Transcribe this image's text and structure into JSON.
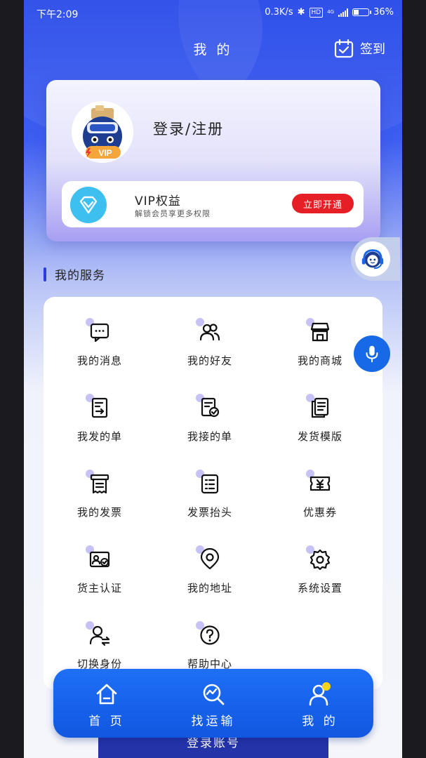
{
  "status_bar": {
    "time": "下午2:09",
    "network_speed": "0.3K/s",
    "hd": "HD",
    "network_type": "4G",
    "battery_percent": 36,
    "battery_text": "36%"
  },
  "header": {
    "title": "我 的",
    "checkin_label": "签到"
  },
  "profile": {
    "login_text": "登录/注册",
    "avatar_badge": "VIP",
    "vip": {
      "title": "VIP权益",
      "subtitle": "解锁会员享更多权限",
      "button": "立即开通"
    }
  },
  "services": {
    "title": "我的服务",
    "items": [
      {
        "label": "我的消息",
        "icon": "message-icon"
      },
      {
        "label": "我的好友",
        "icon": "friends-icon"
      },
      {
        "label": "我的商城",
        "icon": "store-icon"
      },
      {
        "label": "我发的单",
        "icon": "sent-order-icon"
      },
      {
        "label": "我接的单",
        "icon": "received-order-icon"
      },
      {
        "label": "发货模版",
        "icon": "template-icon"
      },
      {
        "label": "我的发票",
        "icon": "invoice-icon"
      },
      {
        "label": "发票抬头",
        "icon": "invoice-header-icon"
      },
      {
        "label": "优惠券",
        "icon": "coupon-icon"
      },
      {
        "label": "货主认证",
        "icon": "certification-icon"
      },
      {
        "label": "我的地址",
        "icon": "location-icon"
      },
      {
        "label": "系统设置",
        "icon": "settings-icon"
      },
      {
        "label": "切换身份",
        "icon": "switch-identity-icon"
      },
      {
        "label": "帮助中心",
        "icon": "help-icon"
      }
    ]
  },
  "login_account": "登录账号",
  "tabbar": [
    {
      "label": "首 页",
      "icon": "home-icon"
    },
    {
      "label": "找运输",
      "icon": "find-transport-icon"
    },
    {
      "label": "我 的",
      "icon": "profile-icon",
      "active": true
    }
  ],
  "colors": {
    "primary": "#1769e8",
    "header_blue": "#2447e8",
    "accent_red": "#e51f25",
    "badge_yellow": "#f7d21c"
  }
}
